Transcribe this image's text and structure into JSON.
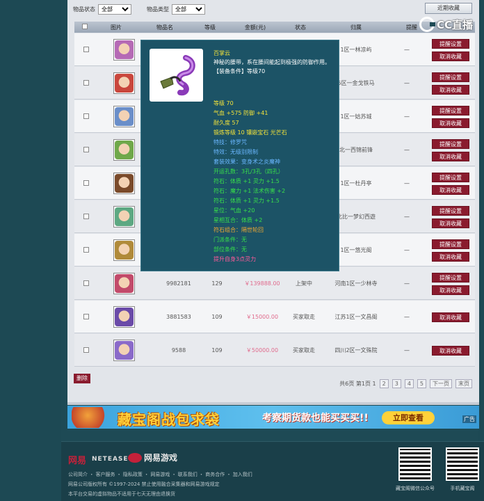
{
  "filters": {
    "status_label": "物品状态",
    "status_value": "全部",
    "type_label": "物品类型",
    "type_value": "全部"
  },
  "recent_label": "近期收藏",
  "watermark": "CC直播",
  "table": {
    "headers": [
      "图片",
      "物品名",
      "等级",
      "金额(元)",
      "状态",
      "归属",
      "提醒"
    ]
  },
  "rows": [
    {
      "id": "",
      "level": "",
      "price": "",
      "status": "",
      "owner": "1区一林凉屿",
      "remind": "—",
      "btns": [
        "提醒设置",
        "取消收藏"
      ],
      "face": "#b56ab5"
    },
    {
      "id": "",
      "level": "",
      "price": "",
      "status": "",
      "owner": "5区一金戈铁马",
      "remind": "—",
      "btns": [
        "提醒设置",
        "取消收藏"
      ],
      "face": "#c9463c"
    },
    {
      "id": "",
      "level": "",
      "price": "",
      "status": "",
      "owner": "1区一姑苏城",
      "remind": "—",
      "btns": [
        "提醒设置",
        "取消收藏"
      ],
      "face": "#6a8ec9"
    },
    {
      "id": "",
      "level": "",
      "price": "",
      "status": "",
      "owner": "北一西锦前锋",
      "remind": "—",
      "btns": [
        "提醒设置",
        "取消收藏"
      ],
      "face": "#6fa84a"
    },
    {
      "id": "",
      "level": "",
      "price": "",
      "status": "",
      "owner": "1区一杜丹亭",
      "remind": "—",
      "btns": [
        "提醒设置",
        "取消收藏"
      ],
      "face": "#7a4a2a"
    },
    {
      "id": "",
      "level": "",
      "price": "",
      "status": "",
      "owner": "北比一梦幻西遊",
      "remind": "—",
      "btns": [
        "提醒设置",
        "取消收藏"
      ],
      "face": "#5da882"
    },
    {
      "id": "",
      "level": "",
      "price": "",
      "status": "",
      "owner": "1区一悠光阁",
      "remind": "—",
      "btns": [
        "提醒设置",
        "取消收藏"
      ],
      "face": "#b08a3a"
    },
    {
      "id": "9982181",
      "level": "129",
      "price": "￥139888.00",
      "status": "上架中",
      "owner": "河南1区一少林寺",
      "remind": "—",
      "btns": [
        "提醒设置",
        "取消收藏"
      ],
      "face": "#c24a6a"
    },
    {
      "id": "3881583",
      "level": "109",
      "price": "￥15000.00",
      "status": "买家取走",
      "owner": "江苏1区一文昌阁",
      "remind": "—",
      "btns": [
        "取消收藏"
      ],
      "face": "#6a4aa8"
    },
    {
      "id": "9588",
      "level": "109",
      "price": "￥50000.00",
      "status": "买家取走",
      "owner": "四川2区一文殊院",
      "remind": "—",
      "btns": [
        "取消收藏"
      ],
      "face": "#8a6ac9"
    }
  ],
  "delete_label": "删除",
  "pager": {
    "summary": "共6页 第1页 1",
    "pages": [
      "2",
      "3",
      "4",
      "5"
    ],
    "next": "下一页",
    "last": "末页"
  },
  "banner": {
    "title": "藏宝阁战包求袋",
    "sub": "考察期货款也能买买买!!",
    "cta": "立即查看",
    "ad": "广告"
  },
  "footer": {
    "netease": "网易",
    "netease_en": "NETEASE",
    "game": "网易游戏",
    "links": "公司简介 ・ 客户服务 ・ 隐私政策 ・ 网易游戏 ・ 联系我们 ・ 商务合作 ・ 加入我们",
    "copyright": "网易公司版权所有 ©1997-2024 禁止使用融合采集器和网易游戏规定",
    "notice": "本平台交易的虚拟物品不适用于七天无理由退换货",
    "qr1_caption": "藏宝阁微信公众号",
    "qr2_caption": "手机藏宝阁"
  },
  "tooltip": {
    "name": "百掌云",
    "desc": "神秘的腰带，系在腰间能起到极强的防御作用。",
    "cond": "【装备条件】等级70",
    "lv": "等级 70",
    "hp": "气血 +575 防御 +41",
    "dur": "耐久度 57",
    "forge": "锻炼等级 10 镶嵌宝石 光芒石",
    "skill": "特技：修罗咒",
    "effect": "特效：无级别限制",
    "suit": "套装效果：变身术之炎魔神",
    "kaiyun": "开运孔数：3孔/3孔（四孔）",
    "fu1": "符石：体质 +1 灵力 +1.5",
    "fu2": "符石：魔力 +1 法术伤害 +2",
    "fu3": "符石：体质 +1 灵力 +1.5",
    "xingwei": "星位：气血 +20",
    "xingxiang": "星相互合：体质 +2",
    "fushi_combo": "符石组合：隔世轮回",
    "menpai": "门派条件：无",
    "buwei": "部位条件：无",
    "tisheng": "提升自身3点灵力"
  }
}
